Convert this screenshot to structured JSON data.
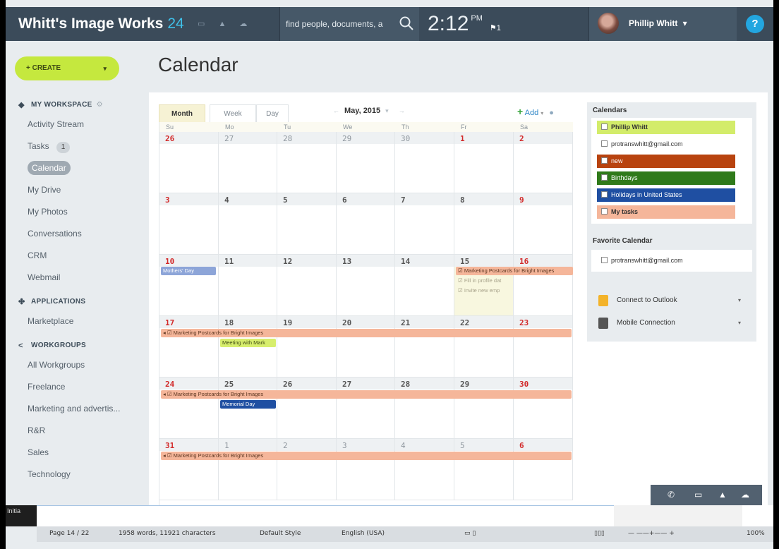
{
  "header": {
    "brand": "Whitt's Image Works",
    "brand_count": "24",
    "search_placeholder": "find people, documents, a",
    "time": "2:12",
    "ampm": "PM",
    "flag_count": "1",
    "user_name": "Phillip Whitt",
    "user_chevron": "▾",
    "help_label": "?"
  },
  "sidebar": {
    "create_label": "+ CREATE",
    "workspace_title": "MY WORKSPACE",
    "workspace_items": [
      {
        "label": "Activity Stream"
      },
      {
        "label": "Tasks",
        "badge": "1"
      },
      {
        "label": "Calendar"
      },
      {
        "label": "My Drive"
      },
      {
        "label": "My Photos"
      },
      {
        "label": "Conversations"
      },
      {
        "label": "CRM"
      },
      {
        "label": "Webmail"
      }
    ],
    "applications_title": "APPLICATIONS",
    "application_items": [
      {
        "label": "Marketplace"
      }
    ],
    "workgroups_title": "WORKGROUPS",
    "workgroup_items": [
      {
        "label": "All Workgroups"
      },
      {
        "label": "Freelance"
      },
      {
        "label": "Marketing and advertis..."
      },
      {
        "label": "R&R"
      },
      {
        "label": "Sales"
      },
      {
        "label": "Technology"
      }
    ]
  },
  "page": {
    "title": "Calendar"
  },
  "calendar": {
    "tabs": [
      "Month",
      "Week",
      "Day"
    ],
    "active_tab": "Month",
    "month_label": "May, 2015",
    "add_label": "Add",
    "day_headers": [
      "Su",
      "Mo",
      "Tu",
      "We",
      "Th",
      "Fr",
      "Sa"
    ],
    "weeks": [
      [
        "26",
        "27",
        "28",
        "29",
        "30",
        "1",
        "2"
      ],
      [
        "3",
        "4",
        "5",
        "6",
        "7",
        "8",
        "9"
      ],
      [
        "10",
        "11",
        "12",
        "13",
        "14",
        "15",
        "16"
      ],
      [
        "17",
        "18",
        "19",
        "20",
        "21",
        "22",
        "23"
      ],
      [
        "24",
        "25",
        "26",
        "27",
        "28",
        "29",
        "30"
      ],
      [
        "31",
        "1",
        "2",
        "3",
        "4",
        "5",
        "6"
      ]
    ],
    "events": {
      "mothers_day": "Mothers' Day",
      "marketing_postcards": "Marketing Postcards for Bright Images",
      "fill_profile": "Fill in profile dat",
      "invite_employees": "Invite new emp",
      "meeting": "Meeting with Mark",
      "memorial_day": "Memorial Day"
    }
  },
  "calendars_panel": {
    "title": "Calendars",
    "items": [
      {
        "label": "Phillip Whitt",
        "color": "#d3ec6a"
      },
      {
        "label": "protranswhitt@gmail.com",
        "color": "#ffffff"
      },
      {
        "label": "new",
        "color": "#b8430f"
      },
      {
        "label": "Birthdays",
        "color": "#2f7a1a"
      },
      {
        "label": "Holidays in United States",
        "color": "#1f4fa2"
      },
      {
        "label": "My tasks",
        "color": "#f5b69a"
      }
    ],
    "favorite_title": "Favorite Calendar",
    "favorite_item": "protranswhitt@gmail.com",
    "connect_outlook": "Connect to Outlook",
    "mobile_connection": "Mobile Connection"
  },
  "doc_status": {
    "initial_label": "Initia",
    "page": "Page 14 / 22",
    "words": "1958 words, 11921 characters",
    "style": "Default Style",
    "language": "English (USA)",
    "zoom": "100%"
  },
  "colors": {
    "header_bg": "#3b4b5a",
    "accent_blue": "#3fc1ea",
    "create_green": "#c5e83e",
    "help_blue": "#23a6e0"
  }
}
